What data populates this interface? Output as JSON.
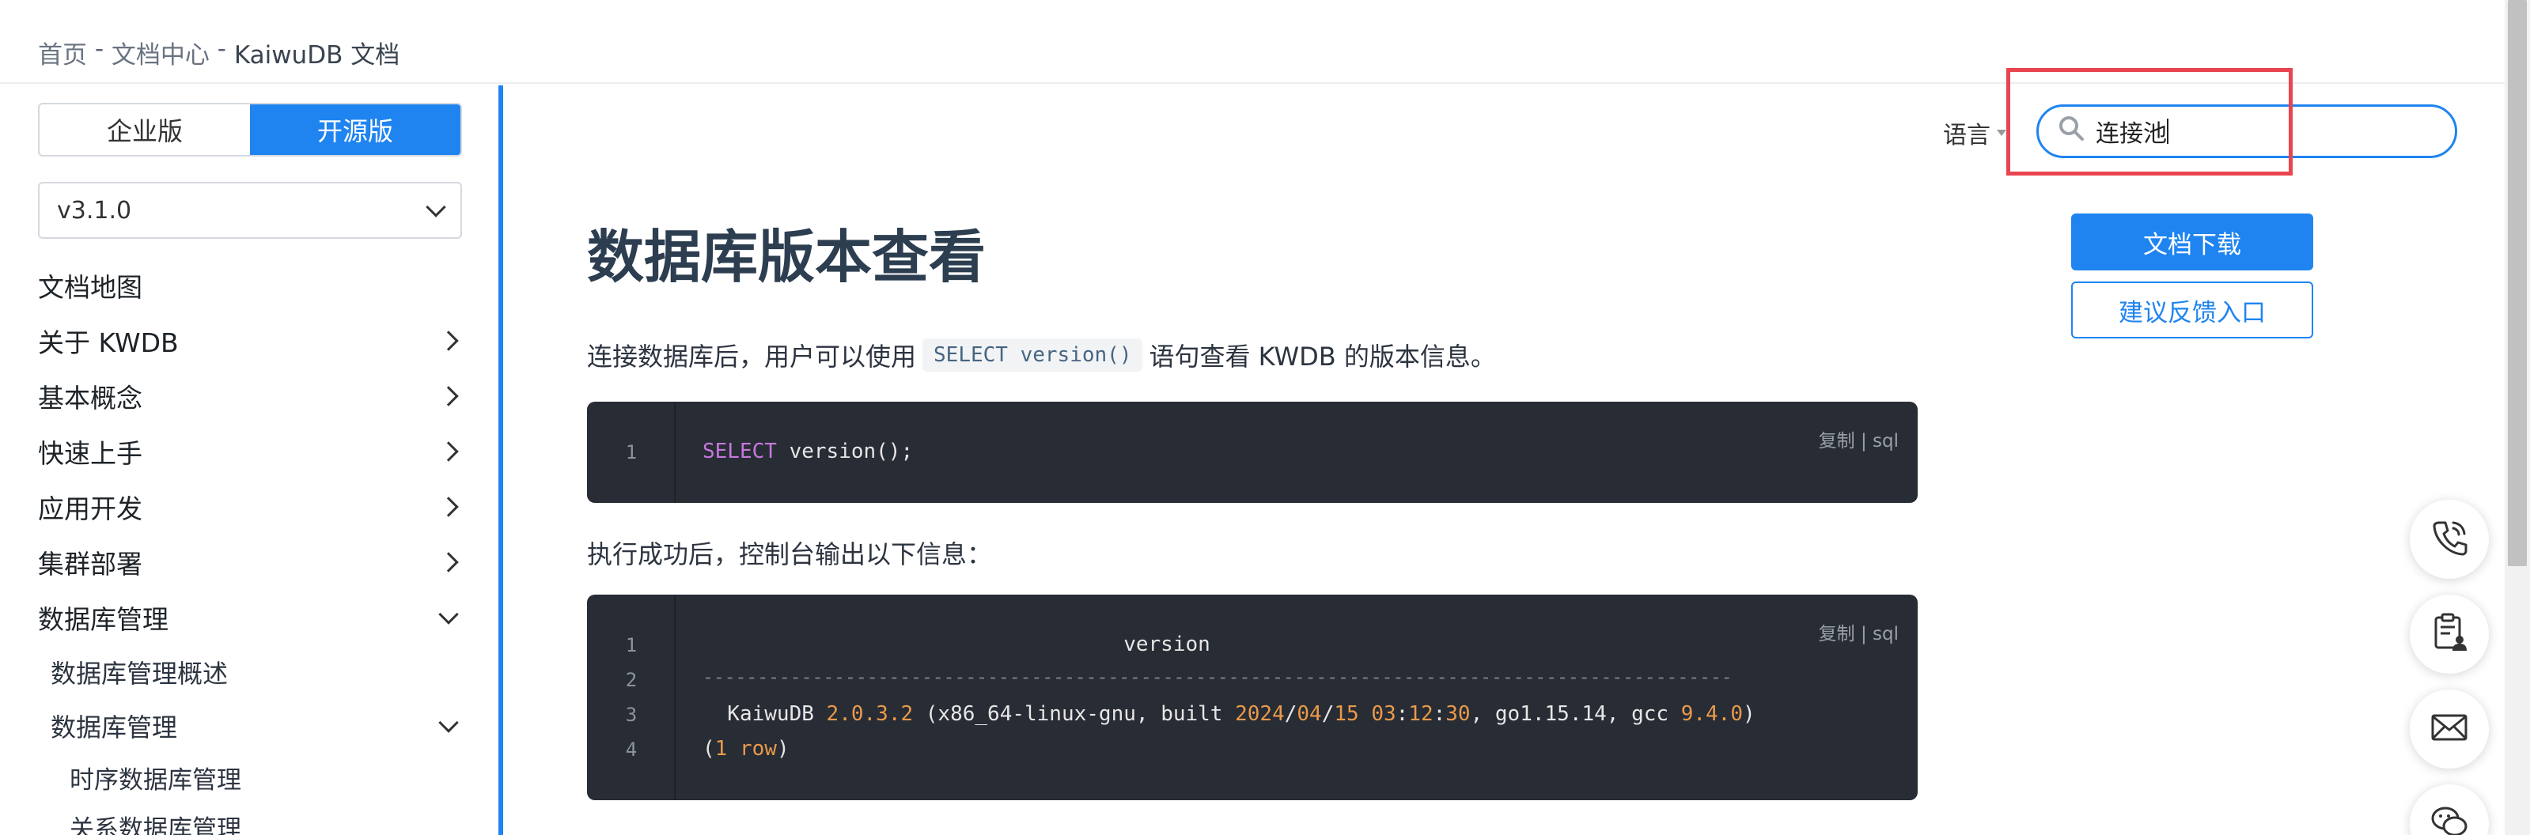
{
  "breadcrumb": {
    "home": "首页",
    "sep1": " - ",
    "docs": "文档中心",
    "sep2": " - ",
    "current": "KaiwuDB 文档"
  },
  "sidebar": {
    "edition_enterprise": "企业版",
    "edition_open": "开源版",
    "version": "v3.1.0",
    "items": [
      {
        "label": "文档地图"
      },
      {
        "label": "关于 KWDB"
      },
      {
        "label": "基本概念"
      },
      {
        "label": "快速上手"
      },
      {
        "label": "应用开发"
      },
      {
        "label": "集群部署"
      },
      {
        "label": "数据库管理"
      }
    ],
    "sub_items": [
      {
        "label": "数据库管理概述"
      },
      {
        "label": "数据库管理"
      }
    ],
    "sub_sub_items": [
      {
        "label": "时序数据库管理"
      },
      {
        "label": "关系数据库管理"
      }
    ]
  },
  "header": {
    "language_label": "语言",
    "search_value": "连接池",
    "download_label": "文档下载",
    "feedback_label": "建议反馈入口"
  },
  "main": {
    "title": "数据库版本查看",
    "intro_before": "连接数据库后，用户可以使用",
    "intro_code": "SELECT version()",
    "intro_after": "语句查看 KWDB 的版本信息。",
    "result_text": "执行成功后，控制台输出以下信息：",
    "copy_label": "复制 | sql",
    "code1": {
      "lines": [
        {
          "num": "1",
          "kw": "SELECT",
          "rest": " version();"
        }
      ]
    },
    "code2": {
      "lines": [
        {
          "num": "1",
          "text": "                                  version"
        },
        {
          "num": "2",
          "text": "----------------------------------------------------------------------------------------------"
        },
        {
          "num": "3",
          "text": "  KaiwuDB 2.0.3.2 (x86_64-linux-gnu, built 2024/04/15 03:12:30, go1.15.14, gcc 9.4.0)"
        },
        {
          "num": "4",
          "text": "(1 row)"
        }
      ]
    }
  },
  "colors": {
    "accent": "#1f84f0",
    "highlight_box": "#e9444f",
    "code_bg": "#282c34"
  },
  "icons": [
    "search-icon",
    "phone-icon",
    "clipboard-user-icon",
    "mail-icon",
    "chat-icon",
    "chevron-right-icon",
    "chevron-down-icon"
  ]
}
